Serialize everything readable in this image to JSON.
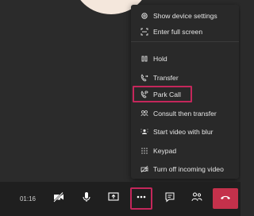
{
  "menu": {
    "items": [
      {
        "label": "Show device settings",
        "icon": "gear-icon"
      },
      {
        "label": "Enter full screen",
        "icon": "fullscreen-icon"
      },
      {
        "label": "Hold",
        "icon": "hold-icon"
      },
      {
        "label": "Transfer",
        "icon": "transfer-icon"
      },
      {
        "label": "Park Call",
        "icon": "park-call-icon"
      },
      {
        "label": "Consult then transfer",
        "icon": "consult-transfer-icon"
      },
      {
        "label": "Start video with blur",
        "icon": "video-blur-icon"
      },
      {
        "label": "Keypad",
        "icon": "keypad-icon"
      },
      {
        "label": "Turn off incoming video",
        "icon": "video-off-icon"
      }
    ]
  },
  "toolbar": {
    "timer": "01:16",
    "buttons": [
      "camera-off-icon",
      "microphone-icon",
      "share-screen-icon",
      "more-options-icon",
      "chat-icon",
      "participants-icon",
      "hang-up-icon"
    ]
  },
  "colors": {
    "highlight": "#c4275b",
    "end_call": "#c4314b",
    "menu_bg": "#292929",
    "toolbar_bg": "#1f1f1f"
  }
}
